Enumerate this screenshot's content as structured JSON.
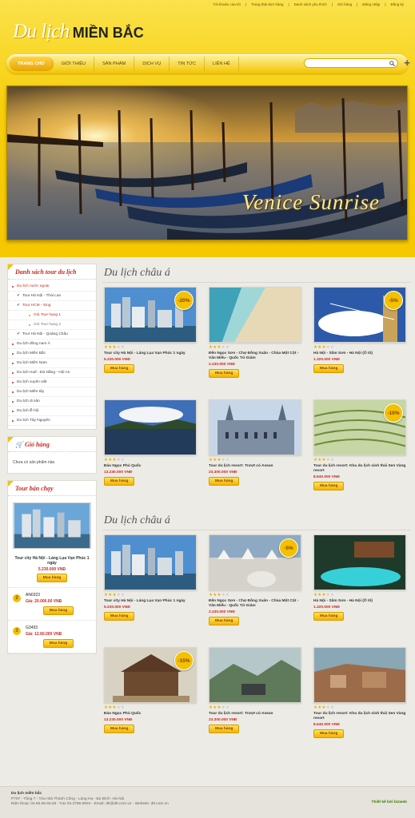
{
  "toplinks": [
    "Tài khoản của tôi",
    "Trang thái đơn hàng",
    "Danh sách yêu thích",
    "Giỏ hàng",
    "Đăng nhập",
    "Đăng ký"
  ],
  "logo": {
    "script": "Du lịch",
    "bold": "MIỀN BẮC"
  },
  "nav": {
    "items": [
      "TRANG CHỦ",
      "GIỚI THIỆU",
      "SẢN PHẨM",
      "DỊCH VỤ",
      "TIN TỨC",
      "LIÊN HỆ"
    ],
    "active": 0
  },
  "search": {
    "placeholder": "",
    "value": ""
  },
  "banner": {
    "title": "Venice Sunrise"
  },
  "sidebar": {
    "categories_title": "Danh sách tour du lịch",
    "categories": [
      {
        "label": "Du lịch nước ngoài",
        "type": "red"
      },
      {
        "label": "Tour Hà Nội - Thái Lan",
        "type": "sub"
      },
      {
        "label": "Tour HCM - Sing",
        "type": "subred"
      },
      {
        "label": "Gói Tour hạng 1",
        "type": "sub2"
      },
      {
        "label": "Gói Tour hạng 2",
        "type": "sub2grey"
      },
      {
        "label": "Tour Hà Nội - Quảng Châu",
        "type": "sub"
      },
      {
        "label": "Du lịch đông nam Á",
        "type": "normal"
      },
      {
        "label": "Du lịch Miền Bắc",
        "type": "normal"
      },
      {
        "label": "Du lịch Miền Nam",
        "type": "normal"
      },
      {
        "label": "Du lịch Huế - Đà Nẵng - Hội An",
        "type": "normal"
      },
      {
        "label": "Du lịch xuyên việt",
        "type": "normal"
      },
      {
        "label": "Du lịch Miền tây",
        "type": "normal"
      },
      {
        "label": "Du lịch di sản",
        "type": "normal"
      },
      {
        "label": "Du lịch lễ hội",
        "type": "normal"
      },
      {
        "label": "Du lịch Tây Nguyên",
        "type": "normal"
      }
    ],
    "cart_title": "Giỏ hàng",
    "cart_empty": "Chưa có sản phẩm nào",
    "bestseller_title": "Tour bán chạy",
    "bestseller_main": {
      "name": "Tour city Hà Nội - Láng Lụa Vạn Phúc 1 ngày",
      "price": "5.230.000 VNĐ",
      "button": "Mua hàng"
    },
    "bestseller_items": [
      {
        "rank": "2",
        "code": "AN0323",
        "price": "Giá: 20.000.00 VNĐ",
        "button": "Mua hàng"
      },
      {
        "rank": "3",
        "code": "G3493",
        "price": "Giá: 12.60.000 VNĐ",
        "button": "Mua hàng"
      }
    ]
  },
  "sections": [
    {
      "title": "Du lịch châu á",
      "products": [
        {
          "name": "Tour city Hà Nội - Láng Lụa Vạn Phúc 1 ngày",
          "price": "5.230.000 VNĐ",
          "discount": "-20%",
          "stars": 3,
          "image": "city"
        },
        {
          "name": "Đền Ngọc Sơn - Chợ Đồng Xuân - Chùa Một Cột - Văn Miếu - Quốc Tử Giám",
          "price": "2.230.000 VNĐ",
          "discount": "",
          "stars": 3,
          "image": "beach"
        },
        {
          "name": "Hà Nội - Sầm Sơn - Hà Nội (Ô tô)",
          "price": "1.320.000 VNĐ",
          "discount": "-5%",
          "stars": 3,
          "image": "sky"
        },
        {
          "name": "Đảo Ngọc Phú Quốc",
          "price": "13.230.000 VNĐ",
          "discount": "",
          "stars": 3,
          "image": "lake"
        },
        {
          "name": "Tour du lịch resort: Trượt cỏ Asean",
          "price": "23.300.000 VNĐ",
          "discount": "",
          "stars": 3,
          "image": "cathedral"
        },
        {
          "name": "Tour du lịch resort: Khu du lịch sinh thái Sen Vàng resort",
          "price": "8.640.000 VNĐ",
          "discount": "-10%",
          "stars": 3,
          "image": "terrace"
        }
      ]
    },
    {
      "title": "Du lịch châu á",
      "products": [
        {
          "name": "Tour city Hà Nội - Láng Lụa Vạn Phúc 1 ngày",
          "price": "5.230.000 VNĐ",
          "discount": "",
          "stars": 3,
          "image": "city"
        },
        {
          "name": "Đền Ngọc Sơn - Chợ Đồng Xuân - Chùa Một Cột - Văn Miếu - Quốc Tử Giám",
          "price": "2.230.000 VNĐ",
          "discount": "-5%",
          "stars": 3,
          "image": "salt"
        },
        {
          "name": "Hà Nội - Sầm Sơn - Hà Nội (Ô tô)",
          "price": "1.320.000 VNĐ",
          "discount": "",
          "stars": 3,
          "image": "pool"
        },
        {
          "name": "Đảo Ngọc Phú Quốc",
          "price": "13.230.000 VNĐ",
          "discount": "-15%",
          "stars": 3,
          "image": "temple"
        },
        {
          "name": "Tour du lịch resort: Trượt cỏ Asean",
          "price": "23.300.000 VNĐ",
          "discount": "",
          "stars": 3,
          "image": "mountain"
        },
        {
          "name": "Tour du lịch resort: Khu du lịch sinh thái Sen Vàng resort",
          "price": "8.640.000 VNĐ",
          "discount": "",
          "stars": 3,
          "image": "village"
        }
      ]
    }
  ],
  "buy_label": "Mua hàng",
  "footer": {
    "title": "Du lịch miền bắc",
    "address": "P707 - Tầng 7 - Tòa nhà Thành Công - Láng Hạ - Ba Đình -Hà Nội",
    "contact": "Điện thoại: 04.66.55.66.55 - Fax 04.3786.8904 - Email: dtt@dtt.com.vn - Website: dtt.com.vn",
    "credit": "Thiết kế bởi bizweb"
  },
  "colors": {
    "accent": "#f5c800",
    "red": "#c8281f",
    "nav_active": "#e4a500"
  }
}
